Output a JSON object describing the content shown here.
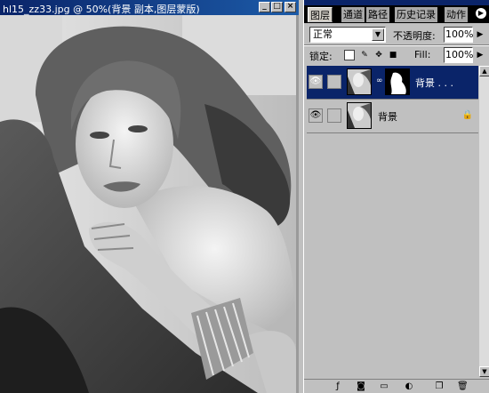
{
  "document": {
    "title": "hl15_zz33.jpg @ 50%(背景 副本,图层蒙版)",
    "controls": {
      "minimize": "_",
      "maximize": "□",
      "close": "×"
    }
  },
  "palette": {
    "tabs": [
      {
        "label": "图层",
        "active": true
      },
      {
        "label": "通道",
        "active": false
      },
      {
        "label": "路径",
        "active": false
      },
      {
        "label": "历史记录",
        "active": false
      },
      {
        "label": "动作",
        "active": false
      }
    ],
    "menu_icon": "triangle-right-icon",
    "blend_mode": "正常",
    "opacity_label": "不透明度:",
    "opacity_value": "100%",
    "lock_label": "锁定:",
    "fill_label": "Fill:",
    "fill_value": "100%",
    "layers": [
      {
        "name": "背景 . . .",
        "selected": true,
        "has_mask": true,
        "visible": true,
        "locked": false
      },
      {
        "name": "背景",
        "selected": false,
        "has_mask": false,
        "visible": true,
        "locked": true
      }
    ],
    "bottom_icons": [
      "layer-style-icon",
      "mask-icon",
      "new-set-icon",
      "adjustment-layer-icon",
      "new-layer-icon",
      "trash-icon"
    ]
  },
  "colors": {
    "title_blue": "#0a2469",
    "panel_gray": "#c0c0c0"
  }
}
